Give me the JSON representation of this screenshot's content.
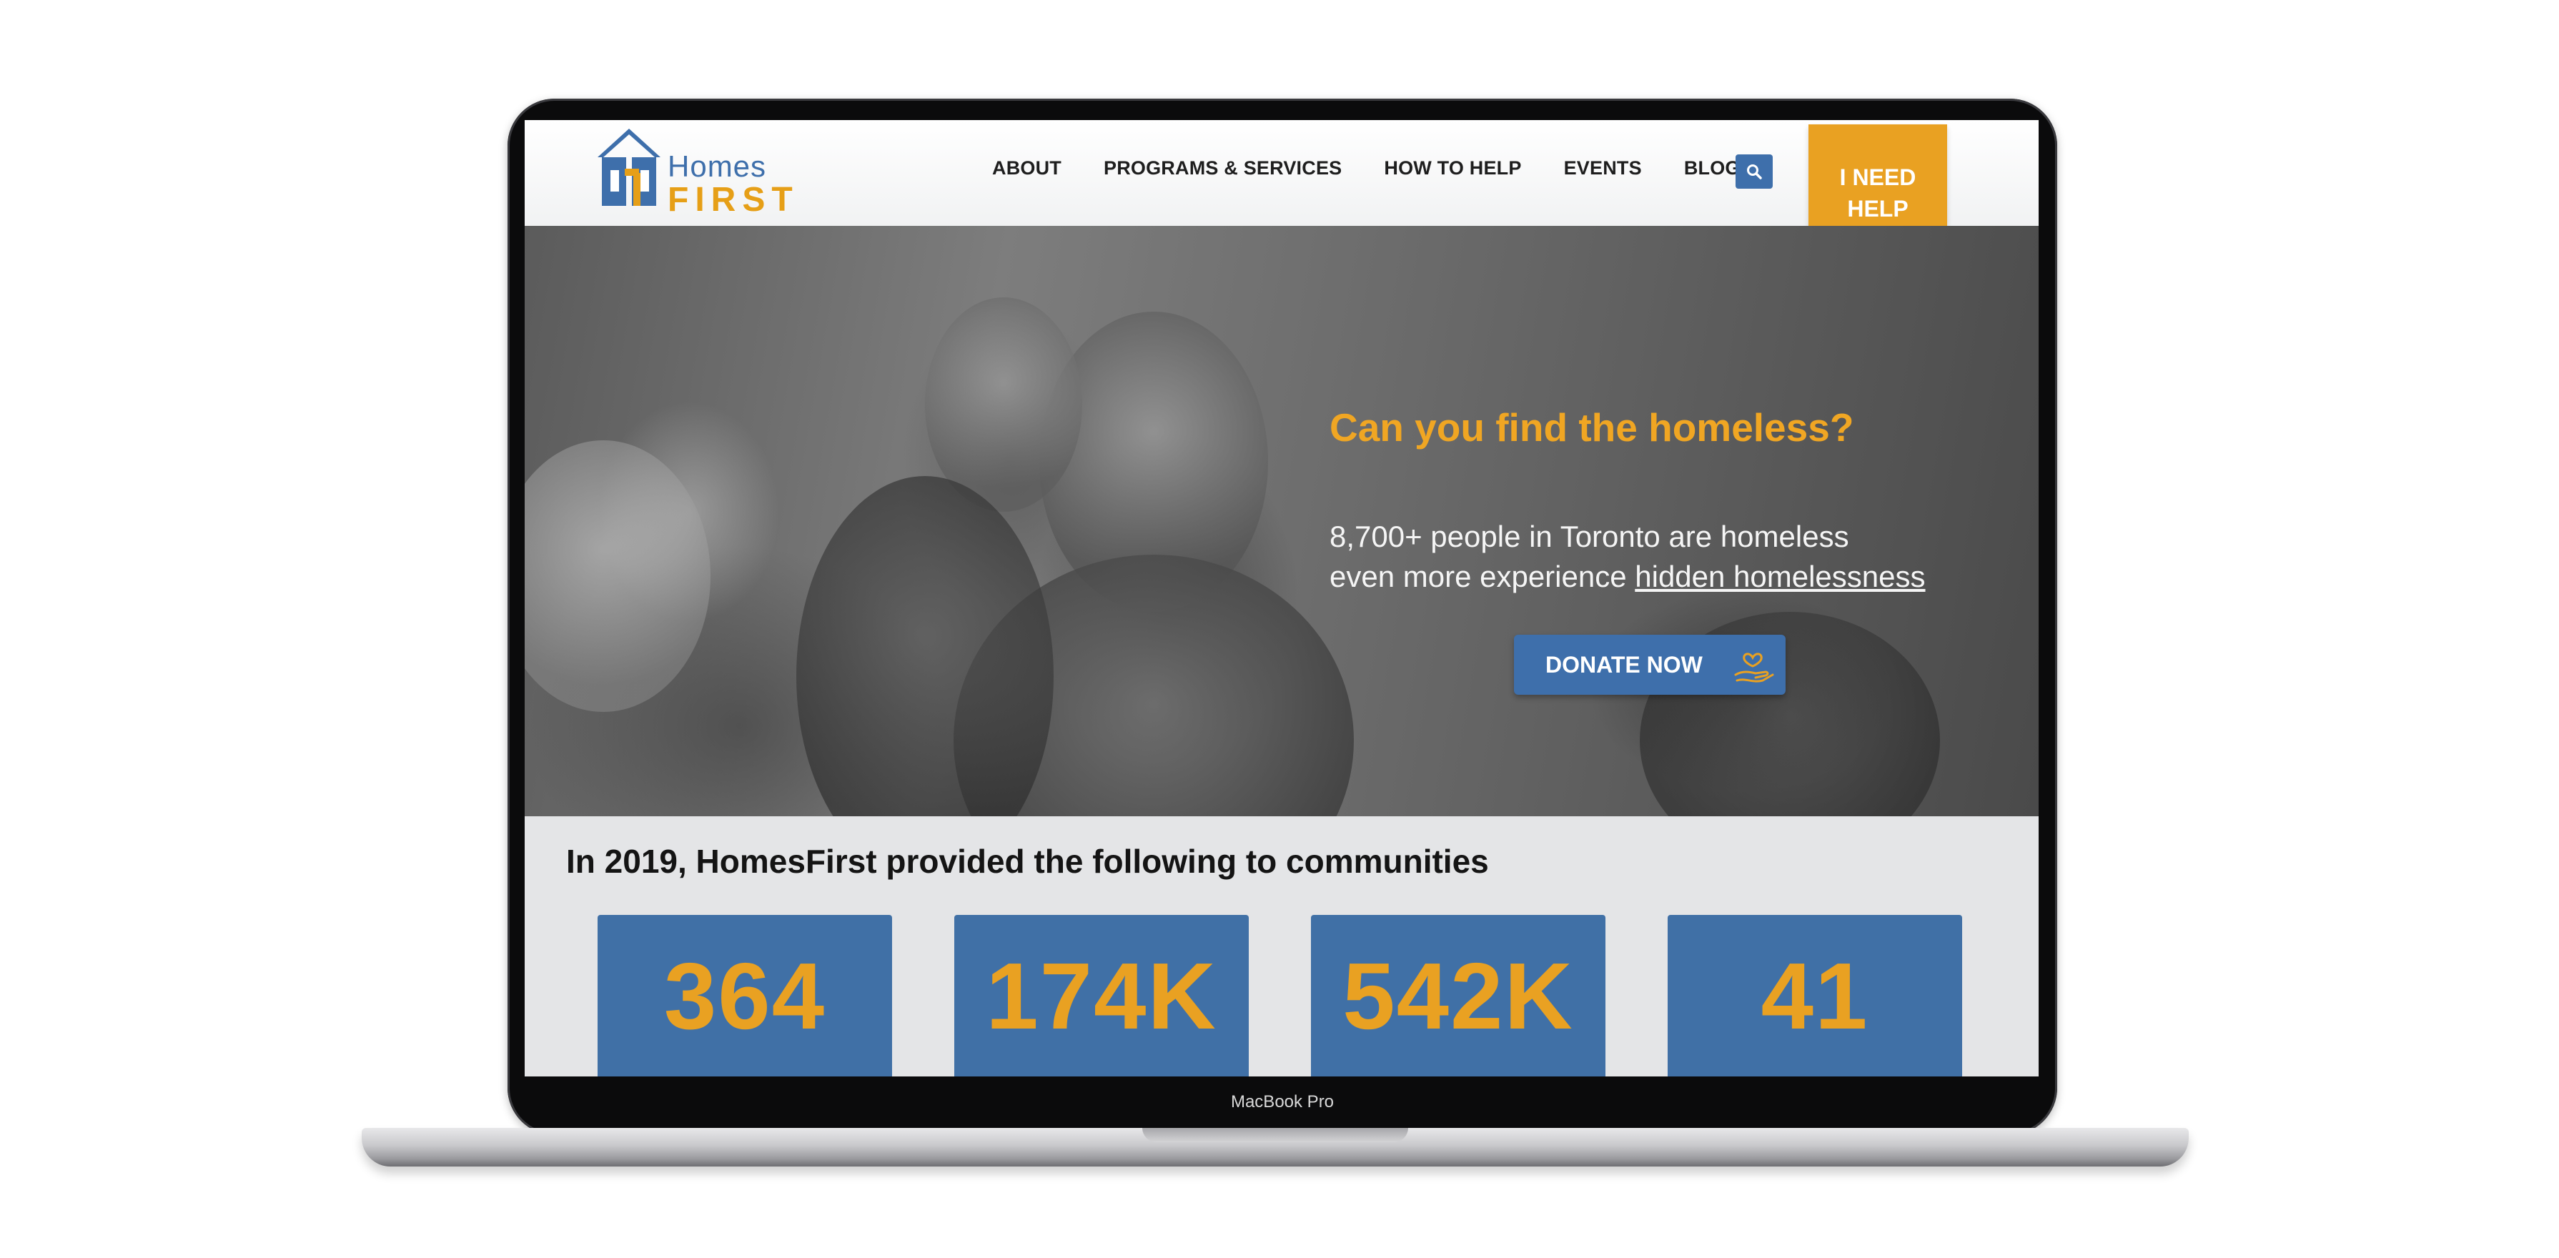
{
  "device": {
    "model_label": "MacBook Pro"
  },
  "logo": {
    "line1": "Homes",
    "line2": "FIRST"
  },
  "nav": {
    "items": [
      "ABOUT",
      "PROGRAMS & SERVICES",
      "HOW TO HELP",
      "EVENTS",
      "BLOG"
    ]
  },
  "header": {
    "help_label": "I NEED HELP"
  },
  "hero": {
    "title": "Can you find the homeless?",
    "line1": "8,700+ people in Toronto are homeless",
    "line2_prefix": "even more experience ",
    "line2_link": "hidden homelessness",
    "donate_label": "DONATE NOW"
  },
  "stats": {
    "heading": "In 2019, HomesFirst provided the following to communities",
    "values": [
      "364",
      "174K",
      "542K",
      "41"
    ]
  },
  "colors": {
    "brand_blue": "#3e6fab",
    "brand_orange": "#e9a122",
    "stat_card": "#4070a6"
  },
  "icons": [
    "house-logo-icon",
    "search-icon",
    "help-person-icon",
    "heart-hand-icon"
  ]
}
